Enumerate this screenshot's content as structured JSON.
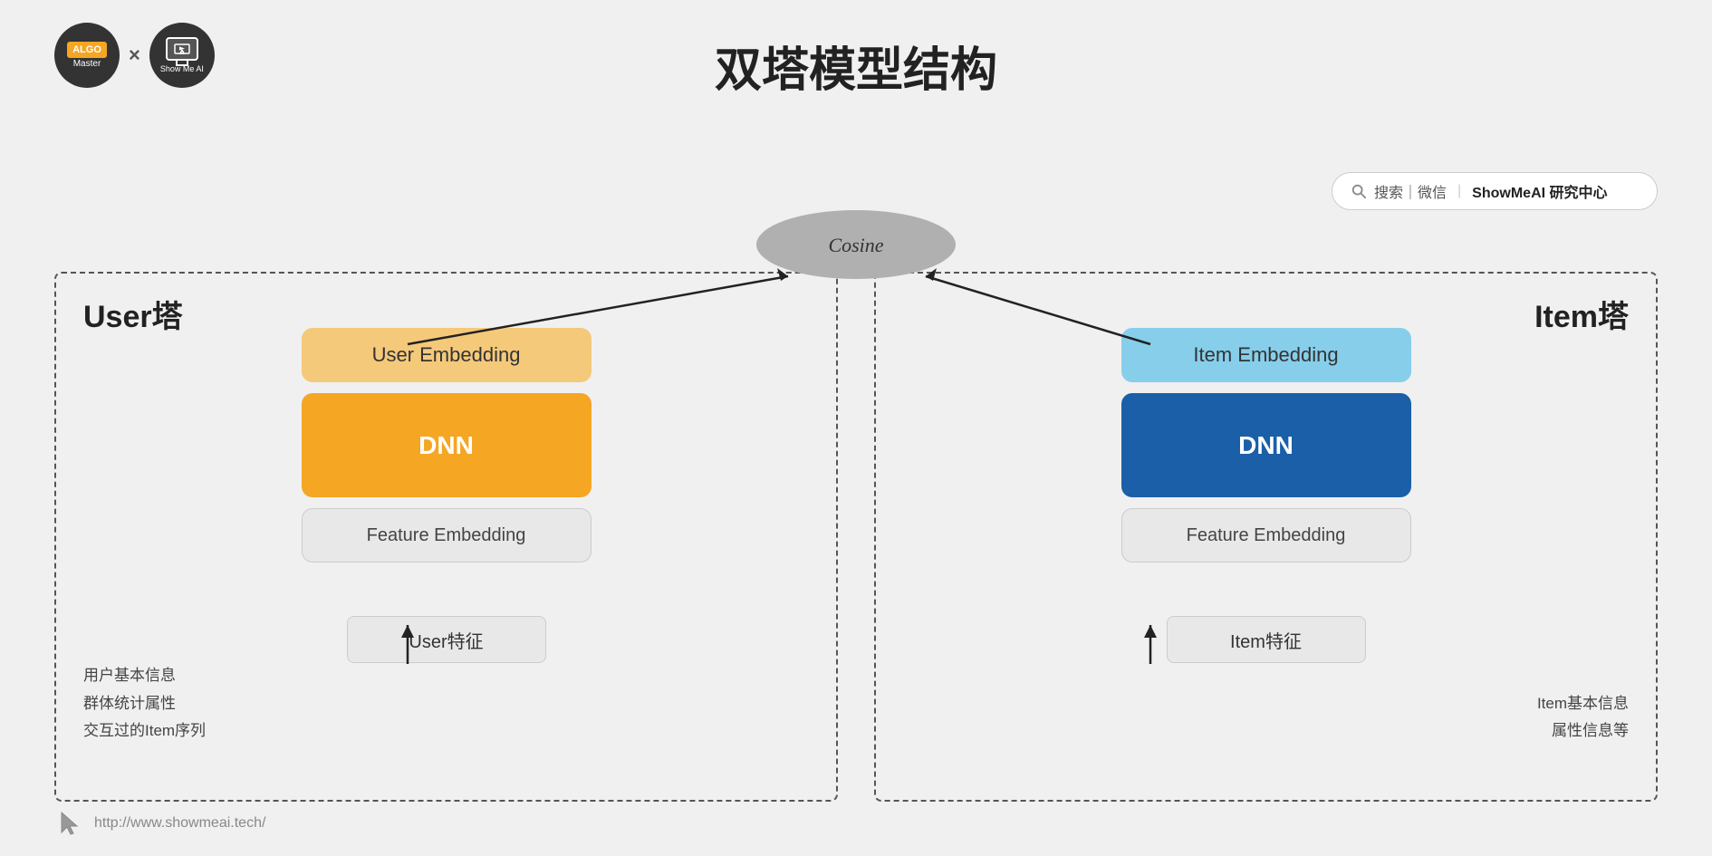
{
  "page": {
    "title": "双塔模型结构",
    "background_color": "#efefef"
  },
  "header": {
    "title": "双塔模型结构",
    "logo_algo_line1": "ALGO",
    "logo_algo_line2": "Master",
    "logo_x": "×",
    "logo_showme_text": "Show Me AI",
    "search_placeholder": "搜索｜微信",
    "search_label": "ShowMeAI 研究中心"
  },
  "cosine": {
    "label": "Cosine"
  },
  "user_tower": {
    "label": "User塔",
    "user_embedding_label": "User Embedding",
    "dnn_label": "DNN",
    "feature_embedding_label": "Feature Embedding",
    "input_label": "User特征",
    "side_text_line1": "用户基本信息",
    "side_text_line2": "群体统计属性",
    "side_text_line3": "交互过的Item序列"
  },
  "item_tower": {
    "label": "Item塔",
    "item_embedding_label": "Item Embedding",
    "dnn_label": "DNN",
    "feature_embedding_label": "Feature Embedding",
    "input_label": "Item特征",
    "side_text_line1": "Item基本信息",
    "side_text_line2": "属性信息等"
  },
  "footer": {
    "url": "http://www.showmeai.tech/"
  }
}
